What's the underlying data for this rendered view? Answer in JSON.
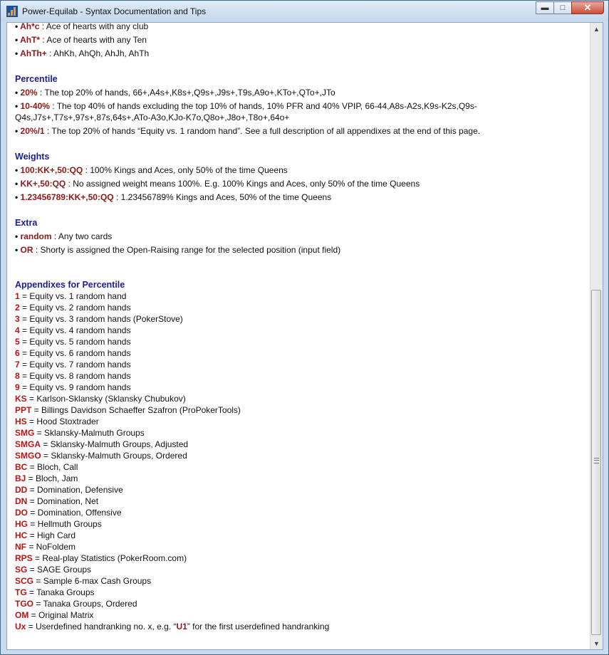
{
  "window": {
    "title": "Power-Equilab - Syntax Documentation and Tips",
    "minimize_icon": "minimize-icon",
    "maximize_icon": "maximize-icon",
    "close_icon": "close-icon"
  },
  "doc": {
    "top": [
      {
        "code": "AhT*",
        "text": " : Ace of hearts with any Ten"
      },
      {
        "code": "AhTh+",
        "text": " : AhKh, AhQh, AhJh, AhTh"
      }
    ],
    "partial_code": "Ah*c",
    "partial_text": " : Ace of hearts with any club",
    "sections": [
      {
        "title": "Percentile",
        "items": [
          {
            "code": "20%",
            "text": " : The top 20% of hands, 66+,A4s+,K8s+,Q9s+,J9s+,T9s,A9o+,KTo+,QTo+,JTo"
          },
          {
            "code": "10-40%",
            "text": " : The top 40% of hands excluding the top 10% of hands, 10% PFR and 40% VPIP, 66-44,A8s-A2s,K9s-K2s,Q9s-Q4s,J7s+,T7s+,97s+,87s,64s+,ATo-A3o,KJo-K7o,Q8o+,J8o+,T8o+,64o+"
          },
          {
            "code": "20%/1",
            "text": " : The top 20% of hands “Equity vs. 1 random hand”. See a full description of all appendixes at the end of this page."
          }
        ]
      },
      {
        "title": "Weights",
        "items": [
          {
            "code": "100:KK+,50:QQ",
            "text": " : 100% Kings and Aces, only 50% of the time Queens"
          },
          {
            "code": "KK+,50:QQ",
            "text": " : No assigned weight means 100%. E.g. 100% Kings and Aces, only 50% of the time Queens"
          },
          {
            "code": "1.23456789:KK+,50:QQ",
            "text": " : 1.23456789% Kings and Aces, 50% of the time Queens"
          }
        ]
      },
      {
        "title": "Extra",
        "items": [
          {
            "code": "random",
            "text": " : Any two cards"
          },
          {
            "code": "OR",
            "text": " : Shorty is assigned the Open-Raising range for the selected position (input field)"
          }
        ]
      }
    ],
    "appendix_title": "Appendixes for Percentile",
    "appendixes": [
      {
        "code": "1",
        "text": " = Equity vs. 1 random hand"
      },
      {
        "code": "2",
        "text": " = Equity vs. 2 random hands"
      },
      {
        "code": "3",
        "text": " = Equity vs. 3 random hands (PokerStove)"
      },
      {
        "code": "4",
        "text": " = Equity vs. 4 random hands"
      },
      {
        "code": "5",
        "text": " = Equity vs. 5 random hands"
      },
      {
        "code": "6",
        "text": " = Equity vs. 6 random hands"
      },
      {
        "code": "7",
        "text": " = Equity vs. 7 random hands"
      },
      {
        "code": "8",
        "text": " = Equity vs. 8 random hands"
      },
      {
        "code": "9",
        "text": " = Equity vs. 9 random hands"
      },
      {
        "code": "KS",
        "text": " = Karlson-Sklansky (Sklansky Chubukov)"
      },
      {
        "code": "PPT",
        "text": " = Billings Davidson Schaeffer Szafron (ProPokerTools)"
      },
      {
        "code": "HS",
        "text": " = Hood Stoxtrader"
      },
      {
        "code": "SMG",
        "text": " = Sklansky-Malmuth Groups"
      },
      {
        "code": "SMGA",
        "text": " = Sklansky-Malmuth Groups, Adjusted"
      },
      {
        "code": "SMGO",
        "text": " = Sklansky-Malmuth Groups, Ordered"
      },
      {
        "code": "BC",
        "text": " = Bloch, Call"
      },
      {
        "code": "BJ",
        "text": " = Bloch, Jam"
      },
      {
        "code": "DD",
        "text": " = Domination, Defensive"
      },
      {
        "code": "DN",
        "text": " = Domination, Net"
      },
      {
        "code": "DO",
        "text": " = Domination, Offensive"
      },
      {
        "code": "HG",
        "text": " = Hellmuth Groups"
      },
      {
        "code": "HC",
        "text": " = High Card"
      },
      {
        "code": "NF",
        "text": " = NoFoldem"
      },
      {
        "code": "RPS",
        "text": " = Real-play Statistics (PokerRoom.com)"
      },
      {
        "code": "SG",
        "text": " = SAGE Groups"
      },
      {
        "code": "SCG",
        "text": " = Sample 6-max Cash Groups"
      },
      {
        "code": "TG",
        "text": " = Tanaka Groups"
      },
      {
        "code": "TGO",
        "text": " = Tanaka Groups, Ordered"
      },
      {
        "code": "OM",
        "text": " = Original Matrix"
      },
      {
        "code": "Ux",
        "text": " = Userdefined handranking no. x, e.g. “U1” for the first userdefined handranking"
      }
    ]
  }
}
